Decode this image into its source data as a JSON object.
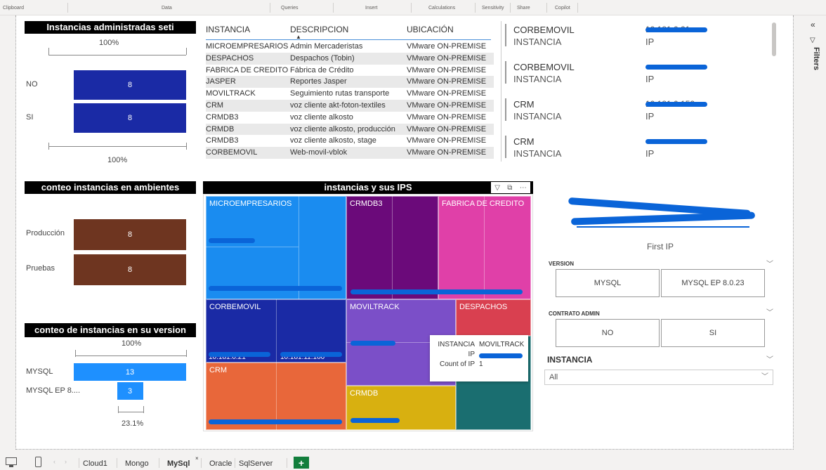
{
  "ribbon": {
    "groups": [
      "Clipboard",
      "Data",
      "Queries",
      "Insert",
      "Calculations",
      "Sensitivity",
      "Share",
      "Copilot"
    ]
  },
  "filters_label": "Filters",
  "visual1": {
    "title": "Instancias administradas seti",
    "top_pct": "100%",
    "bottom_pct": "100%",
    "rows": [
      {
        "label": "NO",
        "value": "8",
        "fraction": 1.0
      },
      {
        "label": "SI",
        "value": "8",
        "fraction": 1.0
      }
    ],
    "color": "#1a2aa5"
  },
  "table": {
    "headers": [
      "INSTANCIA",
      "DESCRIPCION",
      "UBICACIÓN"
    ],
    "rows": [
      [
        "MICROEMPRESARIOS",
        "Admin Mercaderistas",
        "VMware ON-PREMISE"
      ],
      [
        "DESPACHOS",
        "Despachos (Tobin)",
        "VMware ON-PREMISE"
      ],
      [
        "FABRICA DE CREDITO",
        "Fábrica de Crédito",
        "VMware ON-PREMISE"
      ],
      [
        "JASPER",
        "Reportes Jasper",
        "VMware ON-PREMISE"
      ],
      [
        "MOVILTRACK",
        "Seguimiento rutas transporte",
        "VMware ON-PREMISE"
      ],
      [
        "CRM",
        "voz cliente akt-foton-textiles",
        "VMware ON-PREMISE"
      ],
      [
        "CRMDB3",
        "voz cliente alkosto",
        "VMware ON-PREMISE"
      ],
      [
        "CRMDB",
        "voz cliente alkosto, producción",
        "VMware ON-PREMISE"
      ],
      [
        "CRMDB3",
        "voz cliente alkosto, stage",
        "VMware ON-PREMISE"
      ],
      [
        "CORBEMOVIL",
        "Web-movil-vblok",
        "VMware ON-PREMISE"
      ]
    ]
  },
  "cards": [
    {
      "name": "CORBEMOVIL",
      "sub": "INSTANCIA",
      "ip_label": "IP",
      "ip_visible": "10.181.0.21"
    },
    {
      "name": "CORBEMOVIL",
      "sub": "INSTANCIA",
      "ip_label": "IP",
      "ip_visible": ""
    },
    {
      "name": "CRM",
      "sub": "INSTANCIA",
      "ip_label": "IP",
      "ip_visible": "10.181.0.152"
    },
    {
      "name": "CRM",
      "sub": "INSTANCIA",
      "ip_label": "IP",
      "ip_visible": ""
    }
  ],
  "visual2": {
    "title": "conteo instancias en ambientes",
    "rows": [
      {
        "label": "Producción",
        "value": "8",
        "fraction": 1.0
      },
      {
        "label": "Pruebas",
        "value": "8",
        "fraction": 1.0
      }
    ],
    "color": "#6e3520"
  },
  "visual3": {
    "title": "conteo de instancias en su version",
    "top_pct": "100%",
    "bottom_pct": "23.1%",
    "rows": [
      {
        "label": "MYSQL",
        "value": "13",
        "fraction": 1.0
      },
      {
        "label": "MYSQL EP 8....",
        "value": "3",
        "fraction": 0.231
      }
    ],
    "color": "#1e90ff"
  },
  "treemap": {
    "title": "instancias y sus IPS",
    "cells": [
      {
        "label": "MICROEMPRESARIOS",
        "color": "#1a8cf0"
      },
      {
        "label": "CRMDB3",
        "color": "#6b0a7a"
      },
      {
        "label": "FABRICA DE CREDITO",
        "color": "#e040a8"
      },
      {
        "label": "CORBEMOVIL",
        "color": "#1a2aa5"
      },
      {
        "label": "MOVILTRACK",
        "color": "#7b4fc8"
      },
      {
        "label": "DESPACHOS",
        "color": "#d94050"
      },
      {
        "label": "CRM",
        "color": "#e8673a"
      },
      {
        "label": "CRMDB",
        "color": "#d8b010"
      },
      {
        "label": "",
        "color": "#1a6e70"
      }
    ],
    "small_labels": [
      "10.181.0.21",
      "10.181.11.100"
    ],
    "tooltip": {
      "rows": [
        {
          "k": "INSTANCIA",
          "v": "MOVILTRACK"
        },
        {
          "k": "IP",
          "v": ""
        },
        {
          "k": "Count of IP",
          "v": "1"
        }
      ]
    }
  },
  "first_ip": {
    "label": "First IP"
  },
  "slicer_version": {
    "title": "VERSION",
    "options": [
      "MYSQL",
      "MYSQL EP 8.0.23"
    ]
  },
  "slicer_contrato": {
    "title": "CONTRATO ADMIN",
    "options": [
      "NO",
      "SI"
    ]
  },
  "slicer_instancia": {
    "title": "INSTANCIA",
    "value": "All"
  },
  "tabs": [
    "Cloud1",
    "Mongo",
    "MySql",
    "Oracle",
    "SqlServer"
  ],
  "active_tab": "MySql"
}
